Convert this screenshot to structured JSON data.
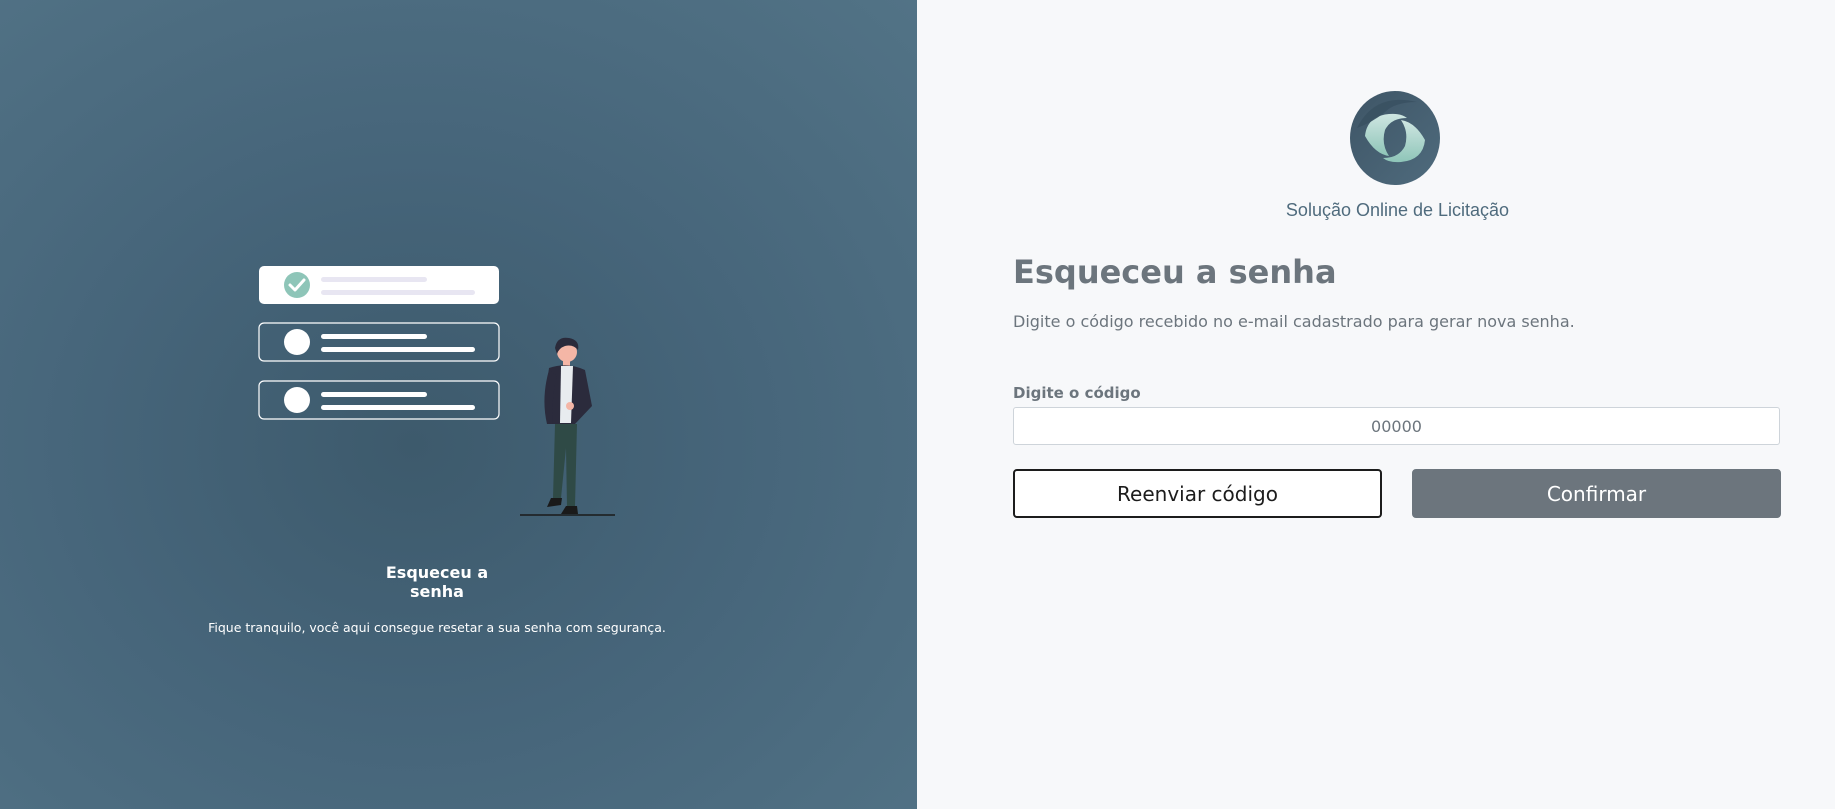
{
  "left_panel": {
    "title_line1": "Esqueceu a",
    "title_line2": "senha",
    "subtitle": "Fique tranquilo, você aqui consegue resetar a sua senha com segurança."
  },
  "brand": {
    "name": "Solução Online de Licitação",
    "logo_icon": "s-swirl-logo-icon"
  },
  "form": {
    "heading": "Esqueceu a senha",
    "description": "Digite o código recebido no e-mail cadastrado para gerar nova senha.",
    "code_label": "Digite o código",
    "code_placeholder": "00000",
    "code_value": "",
    "resend_label": "Reenviar código",
    "confirm_label": "Confirmar"
  },
  "colors": {
    "left_bg": "#46657a",
    "right_bg": "#f7f8fa",
    "heading": "#6c757d",
    "confirm_bg": "#6c757d",
    "brand_text": "#4f6b7d",
    "check_accent": "#8ec5b8"
  }
}
